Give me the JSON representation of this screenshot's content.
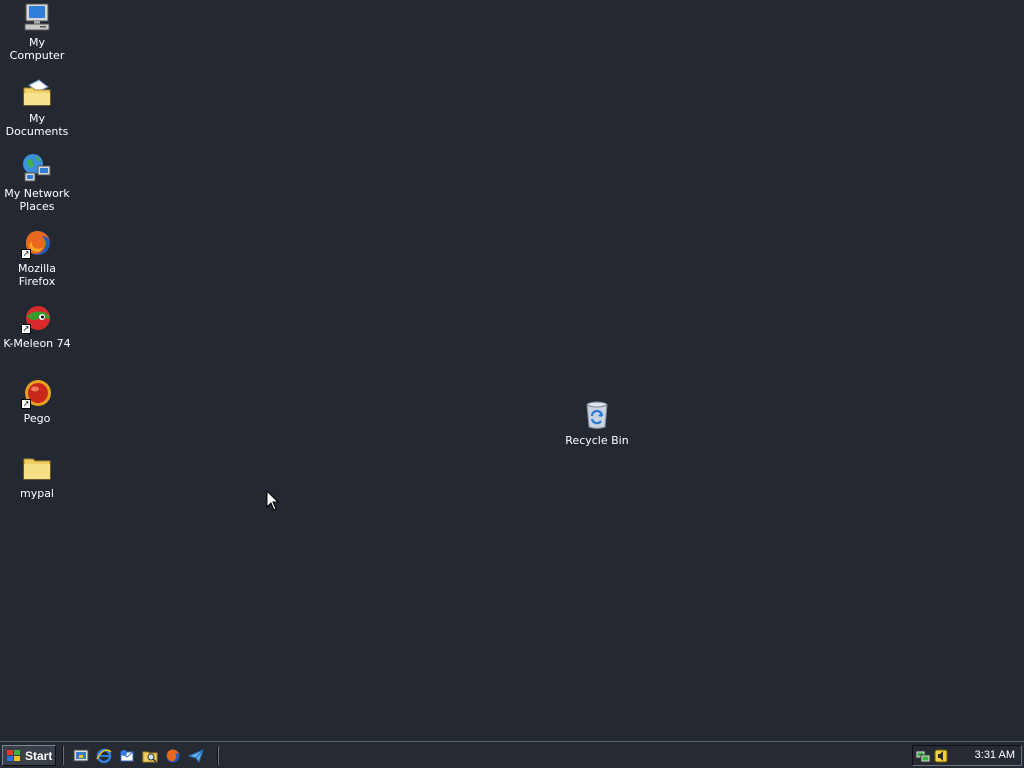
{
  "desktop": {
    "background_color": "#232831",
    "icons": [
      {
        "label": "My Computer",
        "icon": "computer-icon"
      },
      {
        "label": "My Documents",
        "icon": "documents-folder-icon"
      },
      {
        "label": "My Network\nPlaces",
        "icon": "network-places-icon"
      },
      {
        "label": "Mozilla Firefox",
        "icon": "firefox-icon"
      },
      {
        "label": "K-Meleon 74",
        "icon": "kmeleon-icon"
      },
      {
        "label": "Pego",
        "icon": "pego-icon"
      },
      {
        "label": "mypal",
        "icon": "folder-icon"
      },
      {
        "label": "Recycle Bin",
        "icon": "recycle-bin-icon"
      }
    ]
  },
  "taskbar": {
    "start_label": "Start",
    "quick_launch": [
      "show-desktop-icon",
      "internet-explorer-icon",
      "outlook-express-icon",
      "explorer-search-icon",
      "firefox-icon",
      "send-icon"
    ],
    "tray_icons": [
      "network-icon",
      "volume-icon"
    ],
    "clock": "3:31 AM"
  }
}
